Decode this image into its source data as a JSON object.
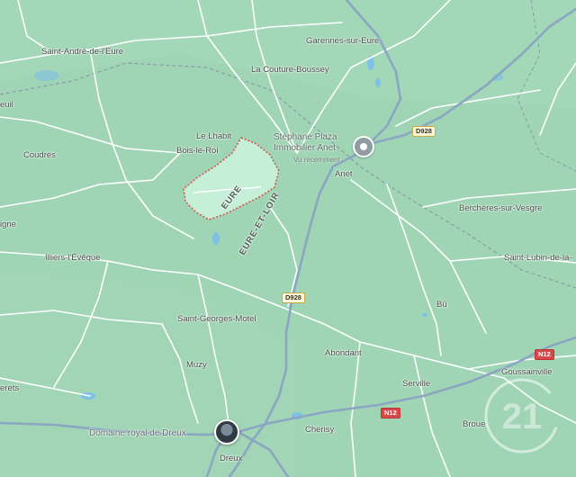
{
  "places": [
    {
      "id": "saint-andre",
      "name": "Saint-André-de-l'Eure"
    },
    {
      "id": "garennes",
      "name": "Garennes-sur-Eure"
    },
    {
      "id": "couture",
      "name": "La Couture-Boussey"
    },
    {
      "id": "euil",
      "name": "euil"
    },
    {
      "id": "lhabit",
      "name": "Le Lhabit"
    },
    {
      "id": "bois-le-roi",
      "name": "Bois-le-Roi"
    },
    {
      "id": "coudres",
      "name": "Coudres"
    },
    {
      "id": "anet",
      "name": "Anet"
    },
    {
      "id": "bercheres",
      "name": "Berchères-sur-Vesgre"
    },
    {
      "id": "vigne",
      "name": "igne"
    },
    {
      "id": "illiers",
      "name": "Illiers-l'Évêque"
    },
    {
      "id": "saint-lubin",
      "name": "Saint-Lubin-de-la-"
    },
    {
      "id": "bu",
      "name": "Bû"
    },
    {
      "id": "saint-georges",
      "name": "Saint-Georges-Motel"
    },
    {
      "id": "abondant",
      "name": "Abondant"
    },
    {
      "id": "muzy",
      "name": "Muzy"
    },
    {
      "id": "serville",
      "name": "Serville"
    },
    {
      "id": "goussainville",
      "name": "Goussainville"
    },
    {
      "id": "erets",
      "name": "erets"
    },
    {
      "id": "cherisy",
      "name": "Cherisy"
    },
    {
      "id": "broue",
      "name": "Broue"
    },
    {
      "id": "dreux",
      "name": "Dreux"
    }
  ],
  "road_shields": [
    {
      "id": "d928-north",
      "label": "D928",
      "type": "departmental"
    },
    {
      "id": "d928-south",
      "label": "D928",
      "type": "departmental"
    },
    {
      "id": "n12-east",
      "label": "N12",
      "type": "national"
    },
    {
      "id": "n12-center",
      "label": "N12",
      "type": "national"
    }
  ],
  "poi": {
    "name_line1": "Stéphane Plaza",
    "name_line2": "Immobilier Anet",
    "subtitle": "Vu récemment",
    "icon": "location-pin-icon"
  },
  "landmark": {
    "name": "Domaine royal de Dreux",
    "icon": "photo-thumbnail"
  },
  "departments": {
    "eure": "EURE",
    "eure_et_loir": "EURE-ET-LOIR"
  },
  "colors": {
    "land": "#9fd5b4",
    "highlight_area": "#c5efd6",
    "boundary": "#d9534f",
    "road_major": "#8ba6c2",
    "road_minor": "#ffffff",
    "water": "#7fc0e6",
    "dept_border": "#8b9aa8"
  },
  "watermark": "C21 logo"
}
